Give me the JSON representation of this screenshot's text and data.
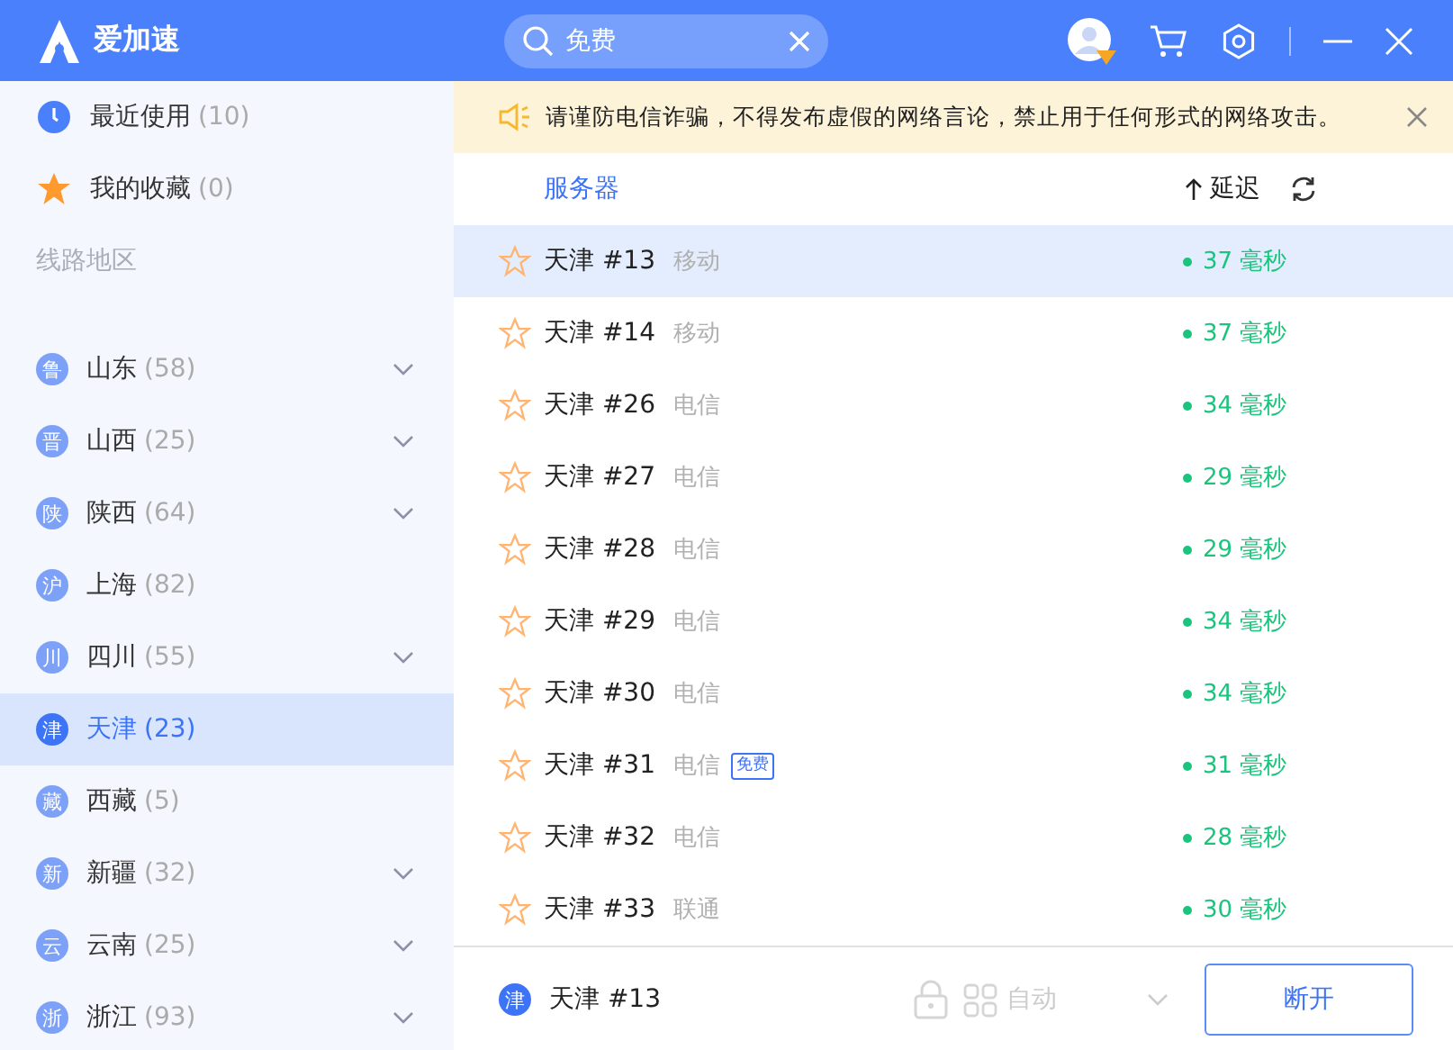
{
  "app": {
    "name": "爱加速"
  },
  "search": {
    "value": "免费"
  },
  "sidebar": {
    "shortcuts": [
      {
        "kind": "recent",
        "label": "最近使用",
        "count": "(10)"
      },
      {
        "kind": "favorites",
        "label": "我的收藏",
        "count": "(0)"
      }
    ],
    "section_title": "线路地区",
    "regions": [
      {
        "badge": "鲁",
        "name": "山东",
        "count": "(58)",
        "expandable": true,
        "selected": false
      },
      {
        "badge": "晋",
        "name": "山西",
        "count": "(25)",
        "expandable": true,
        "selected": false
      },
      {
        "badge": "陕",
        "name": "陕西",
        "count": "(64)",
        "expandable": true,
        "selected": false
      },
      {
        "badge": "沪",
        "name": "上海",
        "count": "(82)",
        "expandable": false,
        "selected": false
      },
      {
        "badge": "川",
        "name": "四川",
        "count": "(55)",
        "expandable": true,
        "selected": false
      },
      {
        "badge": "津",
        "name": "天津",
        "count": "(23)",
        "expandable": false,
        "selected": true
      },
      {
        "badge": "藏",
        "name": "西藏",
        "count": "(5)",
        "expandable": false,
        "selected": false
      },
      {
        "badge": "新",
        "name": "新疆",
        "count": "(32)",
        "expandable": true,
        "selected": false
      },
      {
        "badge": "云",
        "name": "云南",
        "count": "(25)",
        "expandable": true,
        "selected": false
      },
      {
        "badge": "浙",
        "name": "浙江",
        "count": "(93)",
        "expandable": true,
        "selected": false
      }
    ]
  },
  "notice": "请谨防电信诈骗，不得发布虚假的网络言论，禁止用于任何形式的网络攻击。",
  "table": {
    "columns": [
      "服务器",
      "延迟"
    ],
    "rows": [
      {
        "name": "天津 #13",
        "carrier": "移动",
        "latency": "37 毫秒",
        "selected": true,
        "favorited": false
      },
      {
        "name": "天津 #14",
        "carrier": "移动",
        "latency": "37 毫秒",
        "selected": false,
        "favorited": false
      },
      {
        "name": "天津 #26",
        "carrier": "电信",
        "latency": "34 毫秒",
        "selected": false,
        "favorited": false
      },
      {
        "name": "天津 #27",
        "carrier": "电信",
        "latency": "29 毫秒",
        "selected": false,
        "favorited": false
      },
      {
        "name": "天津 #28",
        "carrier": "电信",
        "latency": "29 毫秒",
        "selected": false,
        "favorited": false
      },
      {
        "name": "天津 #29",
        "carrier": "电信",
        "latency": "34 毫秒",
        "selected": false,
        "favorited": false
      },
      {
        "name": "天津 #30",
        "carrier": "电信",
        "latency": "34 毫秒",
        "selected": false,
        "favorited": false
      },
      {
        "name": "天津 #31",
        "carrier": "电信",
        "tag": "免费",
        "latency": "31 毫秒",
        "selected": false,
        "favorited": false
      },
      {
        "name": "天津 #32",
        "carrier": "电信",
        "latency": "28 毫秒",
        "selected": false,
        "favorited": false
      },
      {
        "name": "天津 #33",
        "carrier": "联通",
        "latency": "30 毫秒",
        "selected": false,
        "favorited": false
      }
    ]
  },
  "footer": {
    "badge": "津",
    "server": "天津 #13",
    "mode": "自动",
    "button": "断开"
  }
}
